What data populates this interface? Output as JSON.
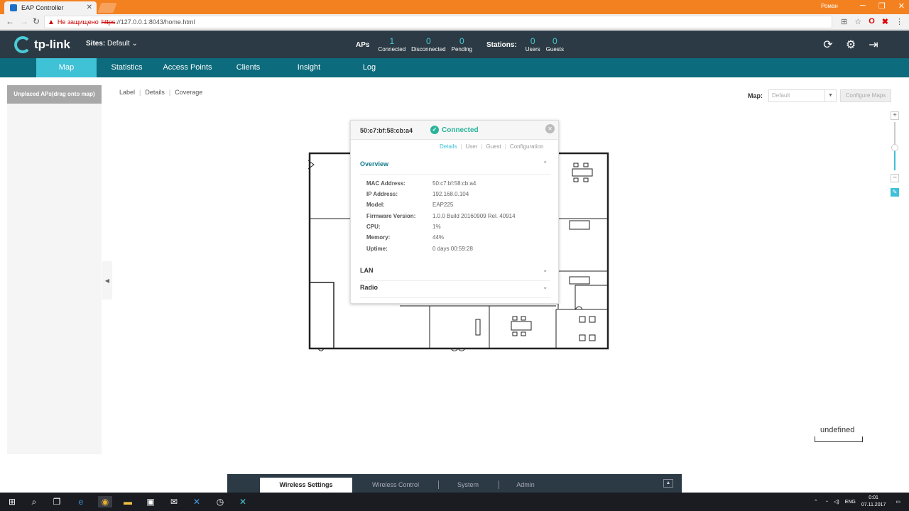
{
  "browser": {
    "tab_title": "EAP Controller",
    "tab_close": "✕",
    "user": "Роман",
    "insecure_label": "Не защищено",
    "url_scheme": "https",
    "url_rest": "://127.0.0.1:8043/home.html"
  },
  "header": {
    "logo_text": "tp-link",
    "sites_label": "Sites:",
    "sites_value": "Default",
    "aps_label": "APs",
    "aps": [
      {
        "value": "1",
        "caption": "Connected"
      },
      {
        "value": "0",
        "caption": "Disconnected"
      },
      {
        "value": "0",
        "caption": "Pending"
      }
    ],
    "stations_label": "Stations:",
    "stations": [
      {
        "value": "0",
        "caption": "Users"
      },
      {
        "value": "0",
        "caption": "Guests"
      }
    ]
  },
  "nav": [
    "Map",
    "Statistics",
    "Access Points",
    "Clients",
    "Insight",
    "Log"
  ],
  "sidebar": {
    "title": "Unplaced APs(drag onto map)"
  },
  "map_tabs": [
    "Label",
    "Details",
    "Coverage"
  ],
  "map_select": {
    "label": "Map:",
    "value": "Default",
    "configure": "Configure Maps"
  },
  "popup": {
    "mac": "50:c7:bf:58:cb:a4",
    "status": "Connected",
    "tabs": [
      "Details",
      "User",
      "Guest",
      "Configuration"
    ],
    "overview_title": "Overview",
    "fields": [
      {
        "key": "MAC Address:",
        "value": "50:c7:bf:58:cb:a4"
      },
      {
        "key": "IP Address:",
        "value": "192.168.0.104"
      },
      {
        "key": "Model:",
        "value": "EAP225"
      },
      {
        "key": "Firmware Version:",
        "value": "1.0.0 Build 20160909 Rel. 40914"
      },
      {
        "key": "CPU:",
        "value": "1%"
      },
      {
        "key": "Memory:",
        "value": "44%"
      },
      {
        "key": "Uptime:",
        "value": "0 days 00:59:28"
      }
    ],
    "lan_title": "LAN",
    "radio_title": "Radio"
  },
  "scale_text": "undefined",
  "bottom_tabs": [
    "Wireless Settings",
    "Wireless Control",
    "System",
    "Admin"
  ],
  "taskbar": {
    "lang": "ENG",
    "time": "0:01",
    "date": "07.11.2017"
  },
  "colors": {
    "accent": "#3fc1d6",
    "nav_bg": "#0c6b7c",
    "header_bg": "#2b3a44",
    "connected": "#2ab39a"
  }
}
